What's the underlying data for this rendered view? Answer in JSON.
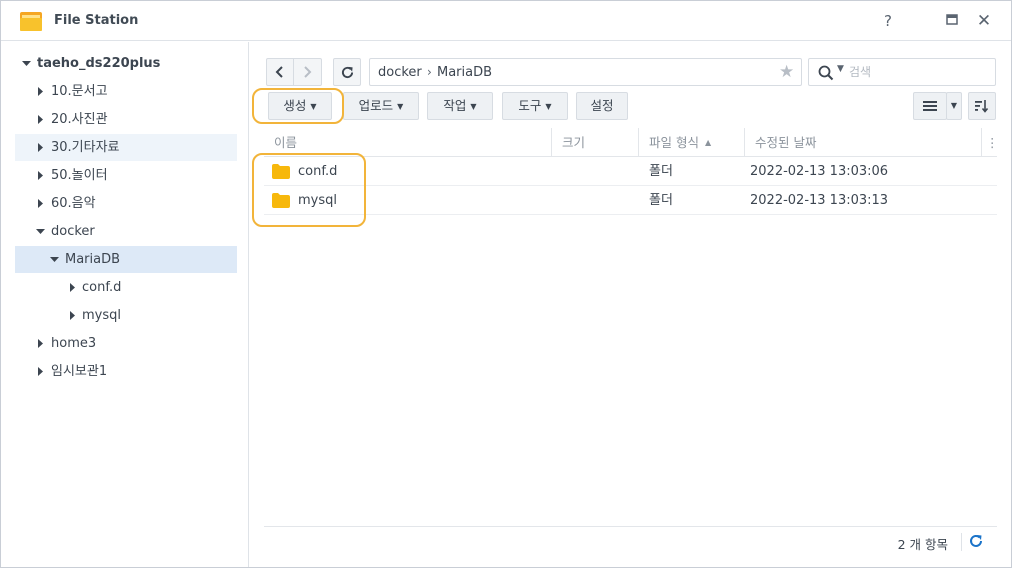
{
  "window": {
    "title": "File Station",
    "help_label": "?",
    "max_label": "□",
    "close_label": "✕"
  },
  "sidebar": {
    "items": [
      {
        "label": "taeho_ds220plus",
        "expanded": true
      },
      {
        "label": "10.문서고",
        "expanded": false
      },
      {
        "label": "20.사진관",
        "expanded": false
      },
      {
        "label": "30.기타자료",
        "expanded": false
      },
      {
        "label": "50.놀이터",
        "expanded": false
      },
      {
        "label": "60.음악",
        "expanded": false
      },
      {
        "label": "docker",
        "expanded": true
      },
      {
        "label": "MariaDB",
        "expanded": true,
        "selected": true
      },
      {
        "label": "conf.d",
        "expanded": false
      },
      {
        "label": "mysql",
        "expanded": false
      },
      {
        "label": "home3",
        "expanded": false
      },
      {
        "label": "임시보관1",
        "expanded": false
      }
    ]
  },
  "pathbar": {
    "crumbs": [
      "docker",
      "MariaDB"
    ],
    "separator": "›"
  },
  "search": {
    "placeholder": "검색"
  },
  "toolbar": {
    "create_label": "생성",
    "upload_label": "업로드",
    "action_label": "작업",
    "tools_label": "도구",
    "settings_label": "설정"
  },
  "table": {
    "columns": [
      "이름",
      "크기",
      "파일 형식",
      "수정된 날짜"
    ],
    "more_label": "⋮",
    "sorted_column": "파일 형식",
    "rows": [
      {
        "name": "conf.d",
        "size": "",
        "type": "폴더",
        "modified": "2022-02-13 13:03:06"
      },
      {
        "name": "mysql",
        "size": "",
        "type": "폴더",
        "modified": "2022-02-13 13:03:13"
      }
    ]
  },
  "footer": {
    "count_label": "2 개 항목"
  },
  "colors": {
    "highlight": "#f2b43a",
    "folder": "#f7b80c",
    "accent": "#1a73c9",
    "selected": "#dde9f7"
  }
}
